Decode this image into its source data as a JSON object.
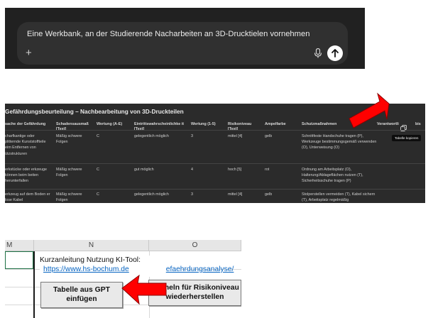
{
  "chat": {
    "prompt": "Eine Werkbank, an der Studierende Nacharbeiten an 3D-Drucktielen vornehmen",
    "plus_glyph": "+",
    "icons": [
      "plus-icon",
      "microphone-icon",
      "send-arrow-icon"
    ]
  },
  "table": {
    "title": "Gefährdungsbeurteilung – Nachbearbeitung von 3D-Druckteilen",
    "headers": [
      "sache der Gefährdung",
      "Schadensausmaß [Text]",
      "Wertung (A-E)",
      "Eintrittswahrscheinlichke it [Text]",
      "Wertung (1-5)",
      "Risikoniveau [Text]",
      "Ampelfarbe",
      "Schutzmaßnahmen",
      "Verantwortli",
      "bis"
    ],
    "rows": [
      [
        "charfkantige oder plitternde Kunststoffteile eim Entfernen von ützstrukturen",
        "Mäßig schwere Folgen",
        "C",
        "gelegentlich möglich",
        "3",
        "mittel [4]",
        "gelb",
        "Schnittfeste Handschuhe tragen (P), Werkzeuge bestimmungsgemäß verwenden (O), Unterweisung (O)"
      ],
      [
        "erkstücke oder erkzeuge können beim beiten herunterfallen",
        "Mäßig schwere Folgen",
        "C",
        "gut möglich",
        "4",
        "hoch [5]",
        "rot",
        "Ordnung am Arbeitsplatz (O), Halterung/Ablageflächen nutzen (T), Sicherheitsschuhe tragen (P)"
      ],
      [
        "erkzeug auf dem Boden er lose Kabel",
        "Mäßig schwere Folgen",
        "C",
        "gelegentlich möglich",
        "3",
        "mittel [4]",
        "gelb",
        "Stolperstellen vermeiden (T), Kabel sichern (T), Arbeitsplatz regelmäßig"
      ]
    ],
    "copy_tooltip": "Tabelle kopieren",
    "icons": [
      "copy-icon"
    ]
  },
  "excel": {
    "columns": [
      "M",
      "N",
      "O"
    ],
    "note_line1": "Kurzanleitung Nutzung KI-Tool:",
    "note_link_visible_a": "https://www.hs-bochum.de",
    "note_link_visible_b": "efaehrdungsanalyse/",
    "btn_paste": "Tabelle aus GPT einfügen",
    "btn_formulas": "Formeln für Risikoniveau wiederherstellen"
  },
  "colors": {
    "chat_bg": "#212121",
    "chat_box": "#303030",
    "table_bg": "#2b2b2b",
    "arrow_red": "#ff0000",
    "excel_grid": "#d8d8d8",
    "link_blue": "#0563c1"
  }
}
